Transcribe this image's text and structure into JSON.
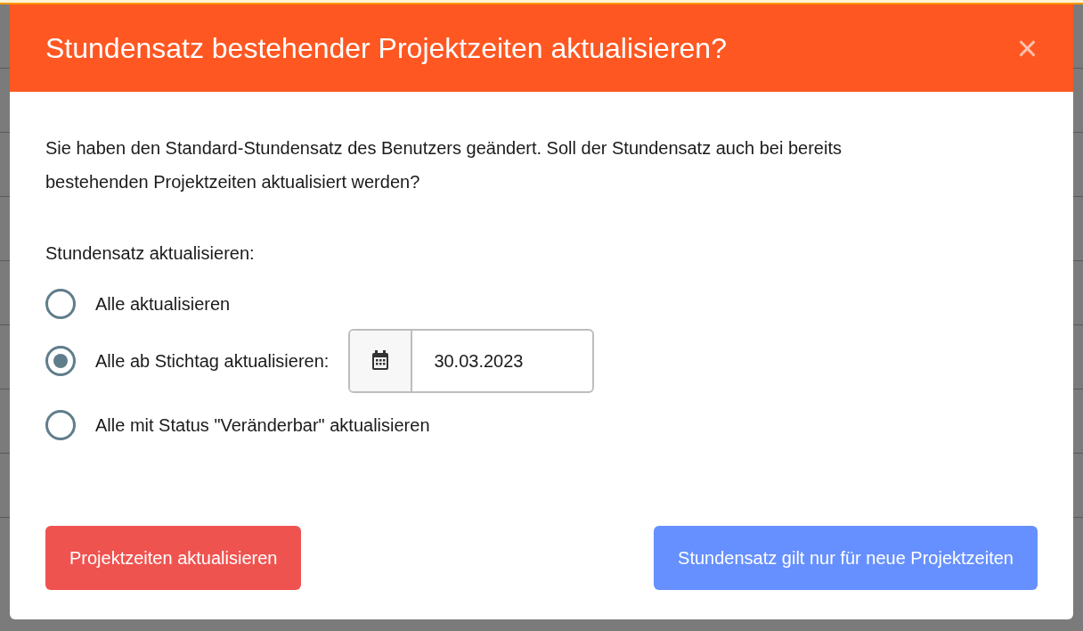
{
  "dialog": {
    "title": "Stundensatz bestehender Projektzeiten aktualisieren?",
    "close": "×",
    "message": "Sie haben den Standard-Stundensatz des Benutzers geändert. Soll der Stundensatz auch bei bereits bestehenden Projektzeiten aktualisiert werden?",
    "group_label": "Stundensatz aktualisieren:",
    "options": [
      {
        "label": "Alle aktualisieren",
        "selected": false
      },
      {
        "label": "Alle ab Stichtag aktualisieren:",
        "selected": true,
        "date": "30.03.2023"
      },
      {
        "label": "Alle mit Status \"Veränderbar\" aktualisieren",
        "selected": false
      }
    ],
    "buttons": [
      {
        "label": "Projektzeiten aktualisieren",
        "kind": "danger"
      },
      {
        "label": "Stundensatz gilt nur für neue Projektzeiten",
        "kind": "primary"
      }
    ]
  }
}
